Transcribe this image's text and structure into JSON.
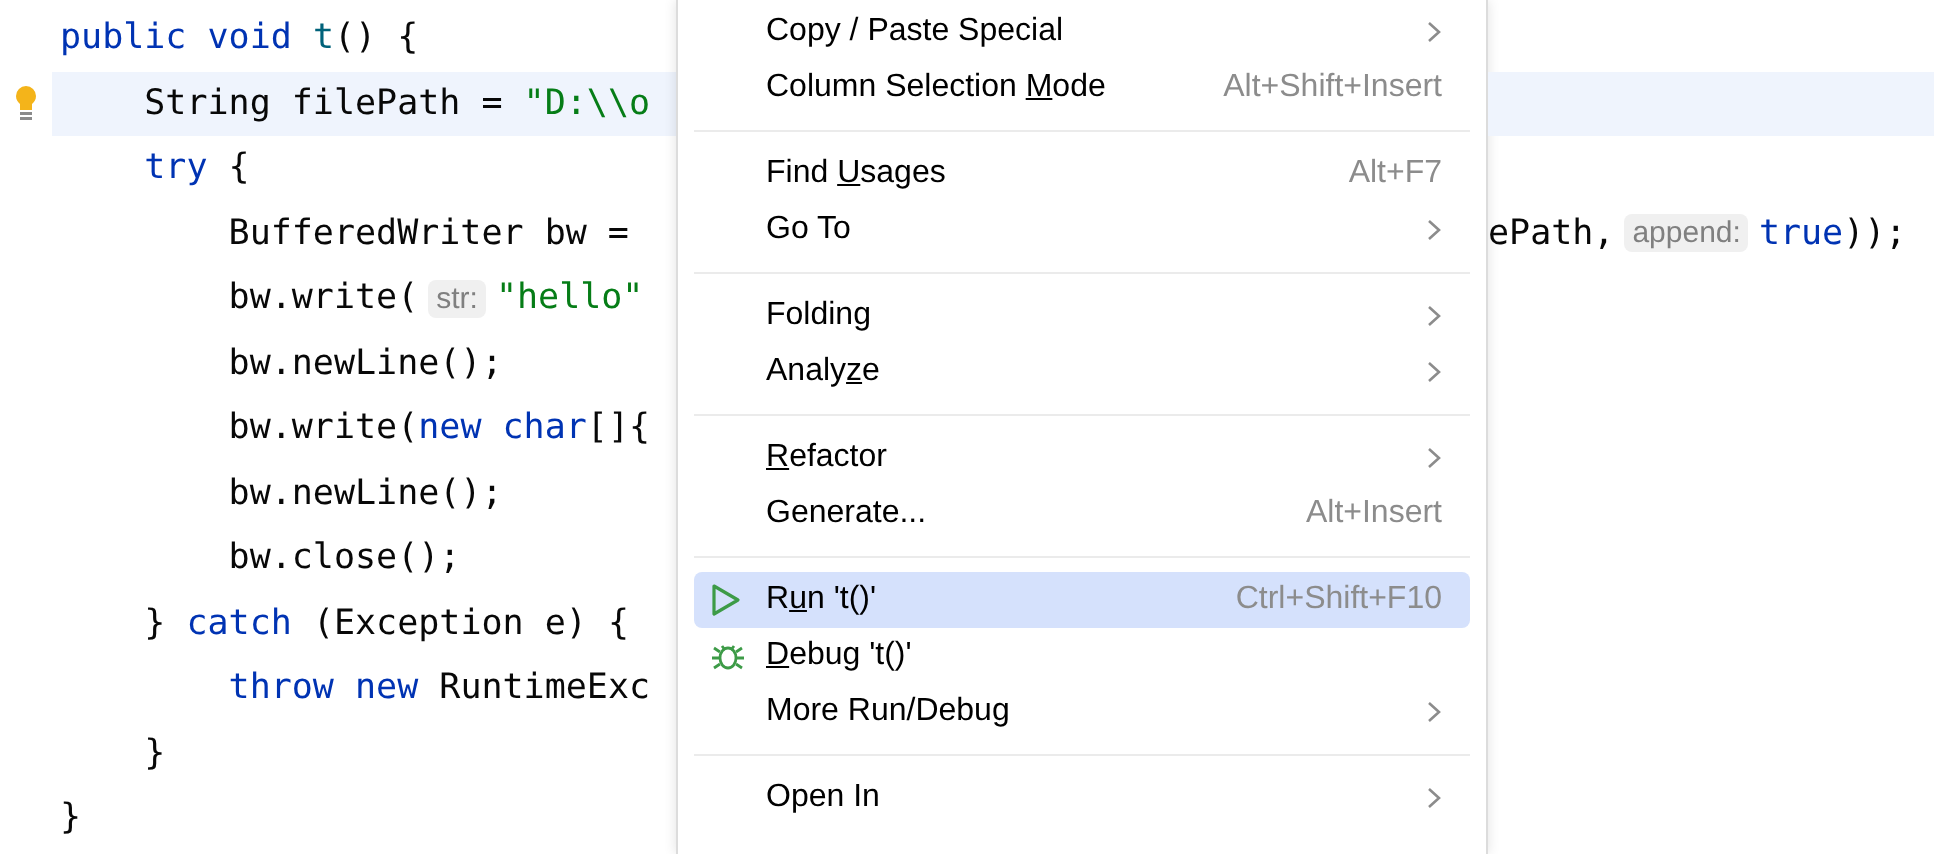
{
  "editor": {
    "lines": [
      {
        "current": false,
        "left": [
          {
            "kind": "keyword",
            "text": "public void "
          },
          {
            "kind": "method",
            "text": "t"
          },
          {
            "kind": "plain",
            "text": "() {"
          }
        ]
      },
      {
        "current": true,
        "left": [
          {
            "kind": "plain",
            "text": "    String filePath = "
          },
          {
            "kind": "string",
            "text": "\"D:\\\\o"
          }
        ]
      },
      {
        "current": false,
        "left": [
          {
            "kind": "keyword",
            "text": "    try"
          },
          {
            "kind": "plain",
            "text": " {"
          }
        ]
      },
      {
        "current": false,
        "left": [
          {
            "kind": "plain",
            "text": "        BufferedWriter bw ="
          }
        ],
        "right": [
          {
            "kind": "plain",
            "text": "ePath,"
          },
          {
            "kind": "hint",
            "text": "append:"
          },
          {
            "kind": "keyword",
            "text": "true"
          },
          {
            "kind": "plain",
            "text": "));"
          }
        ]
      },
      {
        "current": false,
        "left": [
          {
            "kind": "plain",
            "text": "        bw.write("
          },
          {
            "kind": "hint",
            "text": "str:"
          },
          {
            "kind": "string",
            "text": "\"hello\""
          }
        ]
      },
      {
        "current": false,
        "left": [
          {
            "kind": "plain",
            "text": "        bw.newLine();"
          }
        ]
      },
      {
        "current": false,
        "left": [
          {
            "kind": "plain",
            "text": "        bw.write("
          },
          {
            "kind": "keyword",
            "text": "new char"
          },
          {
            "kind": "plain",
            "text": "[]{"
          }
        ]
      },
      {
        "current": false,
        "left": [
          {
            "kind": "plain",
            "text": "        bw.newLine();"
          }
        ]
      },
      {
        "current": false,
        "left": [
          {
            "kind": "plain",
            "text": "        bw.close();"
          }
        ]
      },
      {
        "current": false,
        "left": [
          {
            "kind": "plain",
            "text": "    } "
          },
          {
            "kind": "keyword",
            "text": "catch"
          },
          {
            "kind": "plain",
            "text": " (Exception e) {"
          }
        ]
      },
      {
        "current": false,
        "left": [
          {
            "kind": "keyword",
            "text": "        throw new"
          },
          {
            "kind": "plain",
            "text": " RuntimeExc"
          }
        ]
      },
      {
        "current": false,
        "left": [
          {
            "kind": "plain",
            "text": "    }"
          }
        ]
      },
      {
        "current": false,
        "left": [
          {
            "kind": "plain",
            "text": "}"
          }
        ]
      }
    ]
  },
  "context_menu": {
    "items": [
      {
        "kind": "item",
        "label": [
          {
            "text": "Copy / Paste Special",
            "underlined": false
          }
        ],
        "submenu": true,
        "selected": false
      },
      {
        "kind": "item",
        "label": [
          {
            "text": "Column Selection ",
            "underlined": false
          },
          {
            "text": "M",
            "underlined": true
          },
          {
            "text": "ode",
            "underlined": false
          }
        ],
        "shortcut": "Alt+Shift+Insert",
        "submenu": false,
        "selected": false
      },
      {
        "kind": "separator"
      },
      {
        "kind": "item",
        "label": [
          {
            "text": "Find ",
            "underlined": false
          },
          {
            "text": "U",
            "underlined": true
          },
          {
            "text": "sages",
            "underlined": false
          }
        ],
        "shortcut": "Alt+F7",
        "submenu": false,
        "selected": false
      },
      {
        "kind": "item",
        "label": [
          {
            "text": "Go To",
            "underlined": false
          }
        ],
        "submenu": true,
        "selected": false
      },
      {
        "kind": "separator"
      },
      {
        "kind": "item",
        "label": [
          {
            "text": "Folding",
            "underlined": false
          }
        ],
        "submenu": true,
        "selected": false
      },
      {
        "kind": "item",
        "label": [
          {
            "text": "Analy",
            "underlined": false
          },
          {
            "text": "z",
            "underlined": true
          },
          {
            "text": "e",
            "underlined": false
          }
        ],
        "submenu": true,
        "selected": false
      },
      {
        "kind": "separator"
      },
      {
        "kind": "item",
        "label": [
          {
            "text": "R",
            "underlined": true
          },
          {
            "text": "efactor",
            "underlined": false
          }
        ],
        "submenu": true,
        "selected": false
      },
      {
        "kind": "item",
        "label": [
          {
            "text": "Generate...",
            "underlined": false
          }
        ],
        "shortcut": "Alt+Insert",
        "submenu": false,
        "selected": false
      },
      {
        "kind": "separator"
      },
      {
        "kind": "run",
        "label": [
          {
            "text": "R",
            "underlined": false
          },
          {
            "text": "u",
            "underlined": true
          },
          {
            "text": "n 't()'",
            "underlined": false
          }
        ],
        "shortcut": "Ctrl+Shift+F10",
        "submenu": false,
        "selected": true
      },
      {
        "kind": "debug",
        "label": [
          {
            "text": "D",
            "underlined": true
          },
          {
            "text": "ebug 't()'",
            "underlined": false
          }
        ],
        "submenu": false,
        "selected": false
      },
      {
        "kind": "item",
        "label": [
          {
            "text": "More Run/Debug",
            "underlined": false
          }
        ],
        "submenu": true,
        "selected": false
      },
      {
        "kind": "separator"
      },
      {
        "kind": "item",
        "label": [
          {
            "text": "Open In",
            "underlined": false
          }
        ],
        "submenu": true,
        "selected": false
      }
    ]
  }
}
